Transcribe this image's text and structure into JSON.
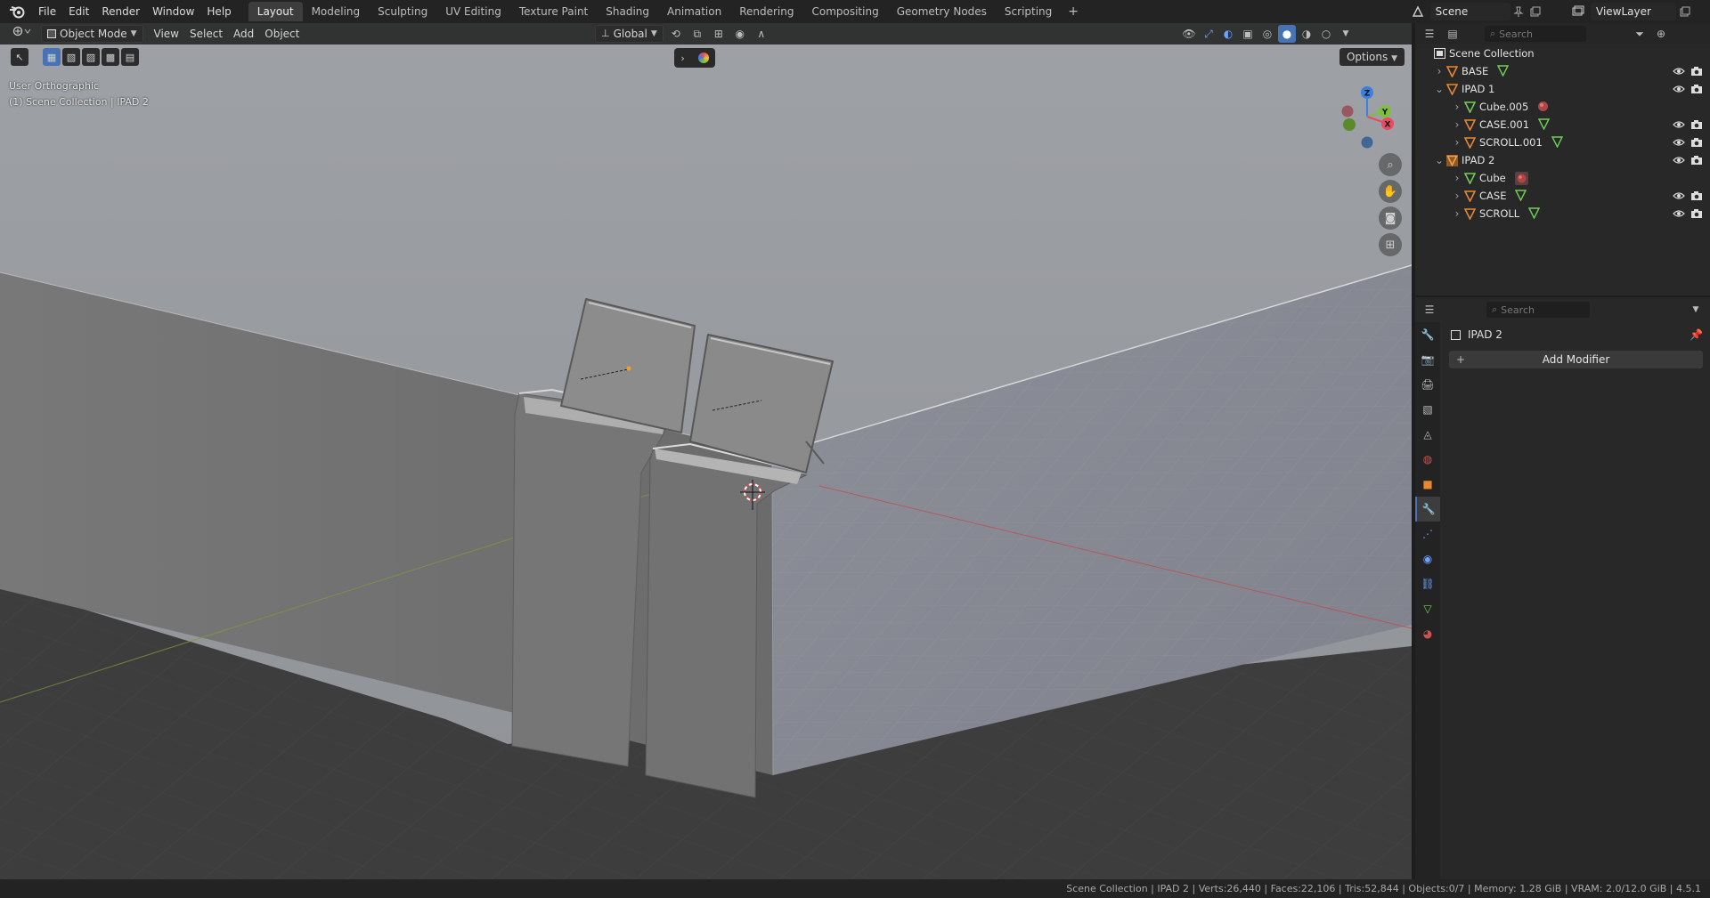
{
  "menu": [
    "File",
    "Edit",
    "Render",
    "Window",
    "Help"
  ],
  "workspaces": [
    {
      "label": "Layout",
      "active": true
    },
    {
      "label": "Modeling",
      "active": false
    },
    {
      "label": "Sculpting",
      "active": false
    },
    {
      "label": "UV Editing",
      "active": false
    },
    {
      "label": "Texture Paint",
      "active": false
    },
    {
      "label": "Shading",
      "active": false
    },
    {
      "label": "Animation",
      "active": false
    },
    {
      "label": "Rendering",
      "active": false
    },
    {
      "label": "Compositing",
      "active": false
    },
    {
      "label": "Geometry Nodes",
      "active": false
    },
    {
      "label": "Scripting",
      "active": false
    }
  ],
  "scene": {
    "label": "Scene"
  },
  "view_layer": {
    "label": "ViewLayer"
  },
  "viewport": {
    "mode": "Object Mode",
    "menus": [
      "View",
      "Select",
      "Add",
      "Object"
    ],
    "transform_orientation": "Global",
    "options_label": "Options",
    "info_view": "User Orthographic",
    "info_context": "(1) Scene Collection | IPAD 2"
  },
  "outliner": {
    "search_placeholder": "Search",
    "root": "Scene Collection",
    "rows": [
      {
        "label": "BASE",
        "level": 0,
        "expanded": false,
        "type": "mesh-object",
        "mod": "mesh",
        "visible": true
      },
      {
        "label": "IPAD 1",
        "level": 0,
        "expanded": true,
        "type": "mesh-object",
        "mod": "",
        "visible": true
      },
      {
        "label": "Cube.005",
        "level": 1,
        "expanded": false,
        "type": "mesh-data",
        "mod": "material",
        "visible": false
      },
      {
        "label": "CASE.001",
        "level": 1,
        "expanded": false,
        "type": "mesh-object",
        "mod": "mesh",
        "visible": true
      },
      {
        "label": "SCROLL.001",
        "level": 1,
        "expanded": false,
        "type": "mesh-object",
        "mod": "mesh",
        "visible": true
      },
      {
        "label": "IPAD 2",
        "level": 0,
        "expanded": true,
        "type": "mesh-object-selected",
        "mod": "",
        "visible": true
      },
      {
        "label": "Cube",
        "level": 1,
        "expanded": false,
        "type": "mesh-data",
        "mod": "material-box",
        "visible": false
      },
      {
        "label": "CASE",
        "level": 1,
        "expanded": false,
        "type": "mesh-object",
        "mod": "mesh",
        "visible": true
      },
      {
        "label": "SCROLL",
        "level": 1,
        "expanded": false,
        "type": "mesh-object",
        "mod": "mesh",
        "visible": true
      }
    ]
  },
  "properties": {
    "search_placeholder": "Search",
    "object_name": "IPAD 2",
    "add_modifier_label": "Add Modifier"
  },
  "statusbar": "Scene Collection | IPAD 2 | Verts:26,440 | Faces:22,106 | Tris:52,844 | Objects:0/7 | Memory: 1.28 GiB | VRAM: 2.0/12.0 GiB | 4.5.1",
  "colors": {
    "accent": "#4772b3",
    "object_orange": "#e8872f",
    "mesh_green": "#6fce55",
    "axis_x": "#e84a5f",
    "axis_y": "#7fc03a",
    "axis_z": "#3b7fe0"
  }
}
